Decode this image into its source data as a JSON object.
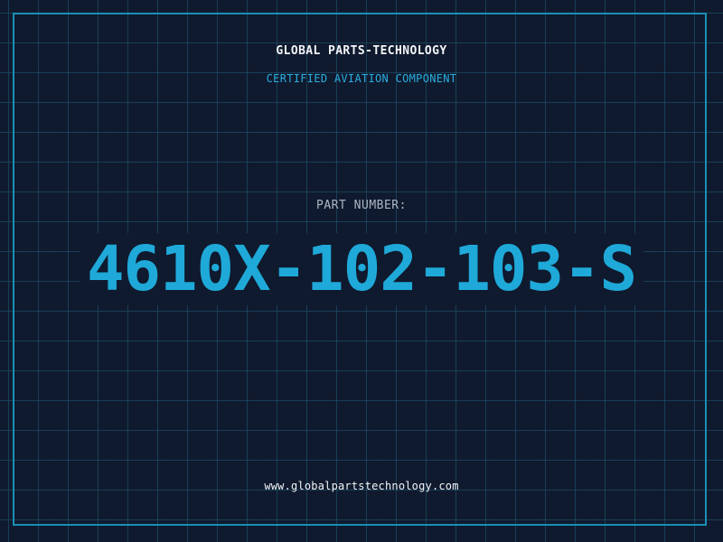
{
  "header": {
    "company": "GLOBAL PARTS-TECHNOLOGY",
    "subtitle": "CERTIFIED AVIATION COMPONENT"
  },
  "part": {
    "label": "PART NUMBER:",
    "number": "4610X-102-103-S"
  },
  "footer": {
    "website": "www.globalpartstechnology.com"
  },
  "colors": {
    "background": "#101a2e",
    "grid": "#205c76",
    "frame": "#1a8fb5",
    "accent": "#1fa9d9",
    "text": "#f2f5f8",
    "muted": "#aab6c4"
  }
}
